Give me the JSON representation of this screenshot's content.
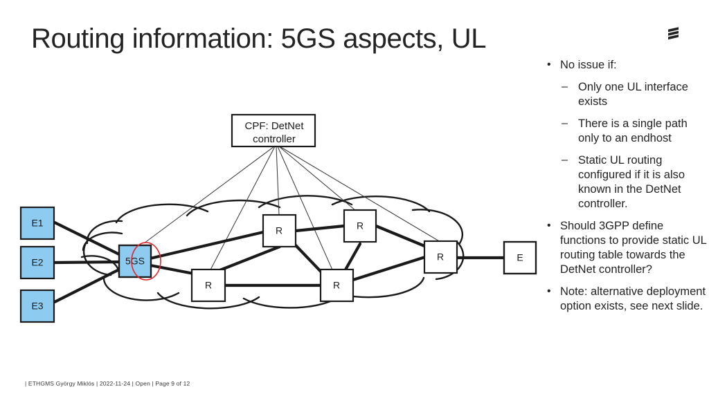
{
  "slide": {
    "title": "Routing information: 5GS aspects, UL",
    "logo_name": "ericsson-logo"
  },
  "footer": {
    "text": "|  ETHGMS György Miklós  |  2022-11-24  |  Open  |  Page 9 of 12"
  },
  "bullets": [
    {
      "level": 1,
      "marker": "•",
      "text": "No issue if:"
    },
    {
      "level": 2,
      "marker": "–",
      "text": "Only one UL interface exists"
    },
    {
      "level": 2,
      "marker": "–",
      "text": "There is a single path only to an endhost"
    },
    {
      "level": 2,
      "marker": "–",
      "text": "Static UL routing configured if it is also known in the DetNet controller."
    },
    {
      "level": 1,
      "marker": "•",
      "text": "Should 3GPP define functions to provide static UL routing table towards the DetNet controller?"
    },
    {
      "level": 1,
      "marker": "•",
      "text": "Note: alternative deployment option exists, see next slide."
    }
  ],
  "diagram": {
    "controller": {
      "line1": "CPF: DetNet",
      "line2": "controller"
    },
    "nodes": {
      "endhost_e1": "E1",
      "endhost_e2": "E2",
      "endhost_e3": "E3",
      "gateway_5gs": "5GS",
      "router_top_left": "R",
      "router_top_right": "R",
      "router_bottom_left": "R",
      "router_bottom_right": "R",
      "router_right": "R",
      "endhost_right": "E"
    },
    "colors": {
      "node_blue": "#8ecbf0",
      "node_white": "#ffffff",
      "stroke": "#1a1a1a",
      "highlight_red": "#e8232a",
      "control_line": "#3a3a3a"
    },
    "annotation": {
      "highlight_name": "ul-interface-highlight-ellipse"
    }
  }
}
